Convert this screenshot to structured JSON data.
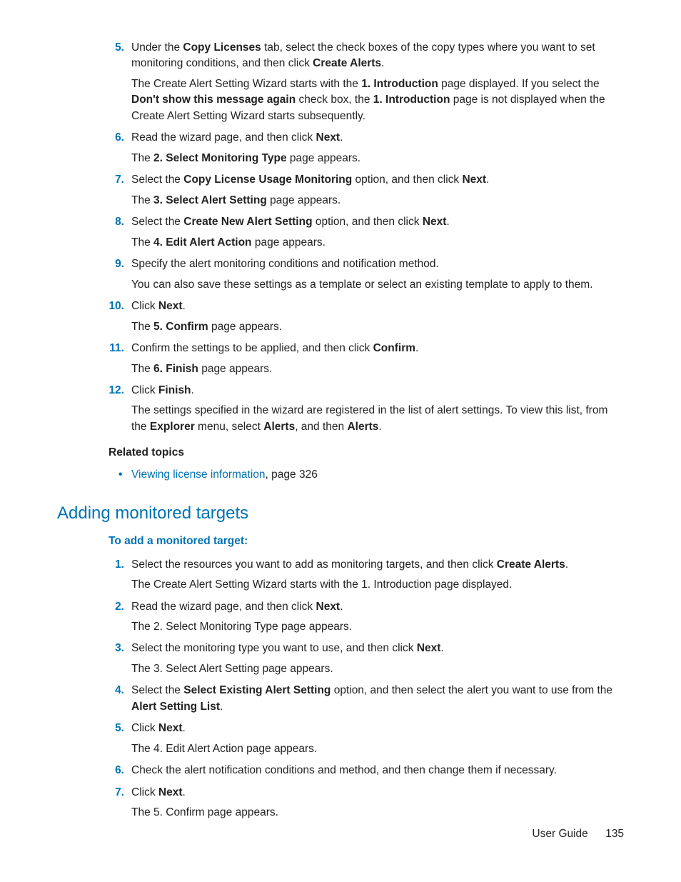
{
  "stepsA": [
    {
      "n": "5.",
      "step": [
        {
          "t": "Under the "
        },
        {
          "t": "Copy Licenses",
          "b": true
        },
        {
          "t": " tab, select the check boxes of the copy types where you want to set monitoring conditions, and then click "
        },
        {
          "t": "Create Alerts",
          "b": true
        },
        {
          "t": "."
        }
      ],
      "result": [
        {
          "t": "The Create Alert Setting Wizard starts with the "
        },
        {
          "t": "1. Introduction",
          "b": true
        },
        {
          "t": " page displayed. If you select the "
        },
        {
          "t": "Don't show this message again",
          "b": true
        },
        {
          "t": " check box, the "
        },
        {
          "t": "1. Introduction",
          "b": true
        },
        {
          "t": " page is not displayed when the Create Alert Setting Wizard starts subsequently."
        }
      ]
    },
    {
      "n": "6.",
      "step": [
        {
          "t": "Read the wizard page, and then click "
        },
        {
          "t": "Next",
          "b": true
        },
        {
          "t": "."
        }
      ],
      "result": [
        {
          "t": "The "
        },
        {
          "t": "2. Select Monitoring Type",
          "b": true
        },
        {
          "t": " page appears."
        }
      ]
    },
    {
      "n": "7.",
      "step": [
        {
          "t": "Select the "
        },
        {
          "t": "Copy License Usage Monitoring",
          "b": true
        },
        {
          "t": " option, and then click "
        },
        {
          "t": "Next",
          "b": true
        },
        {
          "t": "."
        }
      ],
      "result": [
        {
          "t": "The "
        },
        {
          "t": "3. Select Alert Setting",
          "b": true
        },
        {
          "t": " page appears."
        }
      ]
    },
    {
      "n": "8.",
      "step": [
        {
          "t": "Select the "
        },
        {
          "t": "Create New Alert Setting",
          "b": true
        },
        {
          "t": " option, and then click "
        },
        {
          "t": "Next",
          "b": true
        },
        {
          "t": "."
        }
      ],
      "result": [
        {
          "t": "The "
        },
        {
          "t": "4. Edit Alert Action",
          "b": true
        },
        {
          "t": " page appears."
        }
      ]
    },
    {
      "n": "9.",
      "step": [
        {
          "t": "Specify the alert monitoring conditions and notification method."
        }
      ],
      "result": [
        {
          "t": "You can also save these settings as a template or select an existing template to apply to them."
        }
      ]
    },
    {
      "n": "10.",
      "step": [
        {
          "t": "Click "
        },
        {
          "t": "Next",
          "b": true
        },
        {
          "t": "."
        }
      ],
      "result": [
        {
          "t": "The "
        },
        {
          "t": "5. Confirm",
          "b": true
        },
        {
          "t": " page appears."
        }
      ]
    },
    {
      "n": "11.",
      "step": [
        {
          "t": "Confirm the settings to be applied, and then click "
        },
        {
          "t": "Confirm",
          "b": true
        },
        {
          "t": "."
        }
      ],
      "result": [
        {
          "t": "The "
        },
        {
          "t": "6. Finish",
          "b": true
        },
        {
          "t": " page appears."
        }
      ]
    },
    {
      "n": "12.",
      "step": [
        {
          "t": "Click "
        },
        {
          "t": "Finish",
          "b": true
        },
        {
          "t": "."
        }
      ],
      "result": [
        {
          "t": "The settings specified in the wizard are registered in the list of alert settings. To view this list, from the "
        },
        {
          "t": "Explorer",
          "b": true
        },
        {
          "t": " menu, select "
        },
        {
          "t": "Alerts",
          "b": true
        },
        {
          "t": ", and then "
        },
        {
          "t": "Alerts",
          "b": true
        },
        {
          "t": "."
        }
      ]
    }
  ],
  "relatedLabel": "Related topics",
  "relatedLinkText": "Viewing license information",
  "relatedLinkSuffix": ", page 326",
  "sectionHeading": "Adding monitored targets",
  "procedureLabel": "To add a monitored target:",
  "stepsB": [
    {
      "n": "1.",
      "step": [
        {
          "t": "Select the resources you want to add as monitoring targets, and then click "
        },
        {
          "t": "Create Alerts",
          "b": true
        },
        {
          "t": "."
        }
      ],
      "result": [
        {
          "t": "The Create Alert Setting Wizard starts with the 1. Introduction page displayed."
        }
      ]
    },
    {
      "n": "2.",
      "step": [
        {
          "t": "Read the wizard page, and then click "
        },
        {
          "t": "Next",
          "b": true
        },
        {
          "t": "."
        }
      ],
      "result": [
        {
          "t": "The 2. Select Monitoring Type page appears."
        }
      ]
    },
    {
      "n": "3.",
      "step": [
        {
          "t": "Select the monitoring type you want to use, and then click "
        },
        {
          "t": "Next",
          "b": true
        },
        {
          "t": "."
        }
      ],
      "result": [
        {
          "t": "The 3. Select Alert Setting page appears."
        }
      ]
    },
    {
      "n": "4.",
      "step": [
        {
          "t": "Select the "
        },
        {
          "t": "Select Existing Alert Setting",
          "b": true
        },
        {
          "t": " option, and then select the alert you want to use from the "
        },
        {
          "t": "Alert Setting List",
          "b": true
        },
        {
          "t": "."
        }
      ]
    },
    {
      "n": "5.",
      "step": [
        {
          "t": "Click "
        },
        {
          "t": "Next",
          "b": true
        },
        {
          "t": "."
        }
      ],
      "result": [
        {
          "t": "The 4. Edit Alert Action page appears."
        }
      ]
    },
    {
      "n": "6.",
      "step": [
        {
          "t": "Check the alert notification conditions and method, and then change them if necessary."
        }
      ]
    },
    {
      "n": "7.",
      "step": [
        {
          "t": "Click "
        },
        {
          "t": "Next",
          "b": true
        },
        {
          "t": "."
        }
      ],
      "result": [
        {
          "t": "The 5. Confirm page appears."
        }
      ]
    }
  ],
  "footerLabel": "User Guide",
  "pageNumber": "135"
}
